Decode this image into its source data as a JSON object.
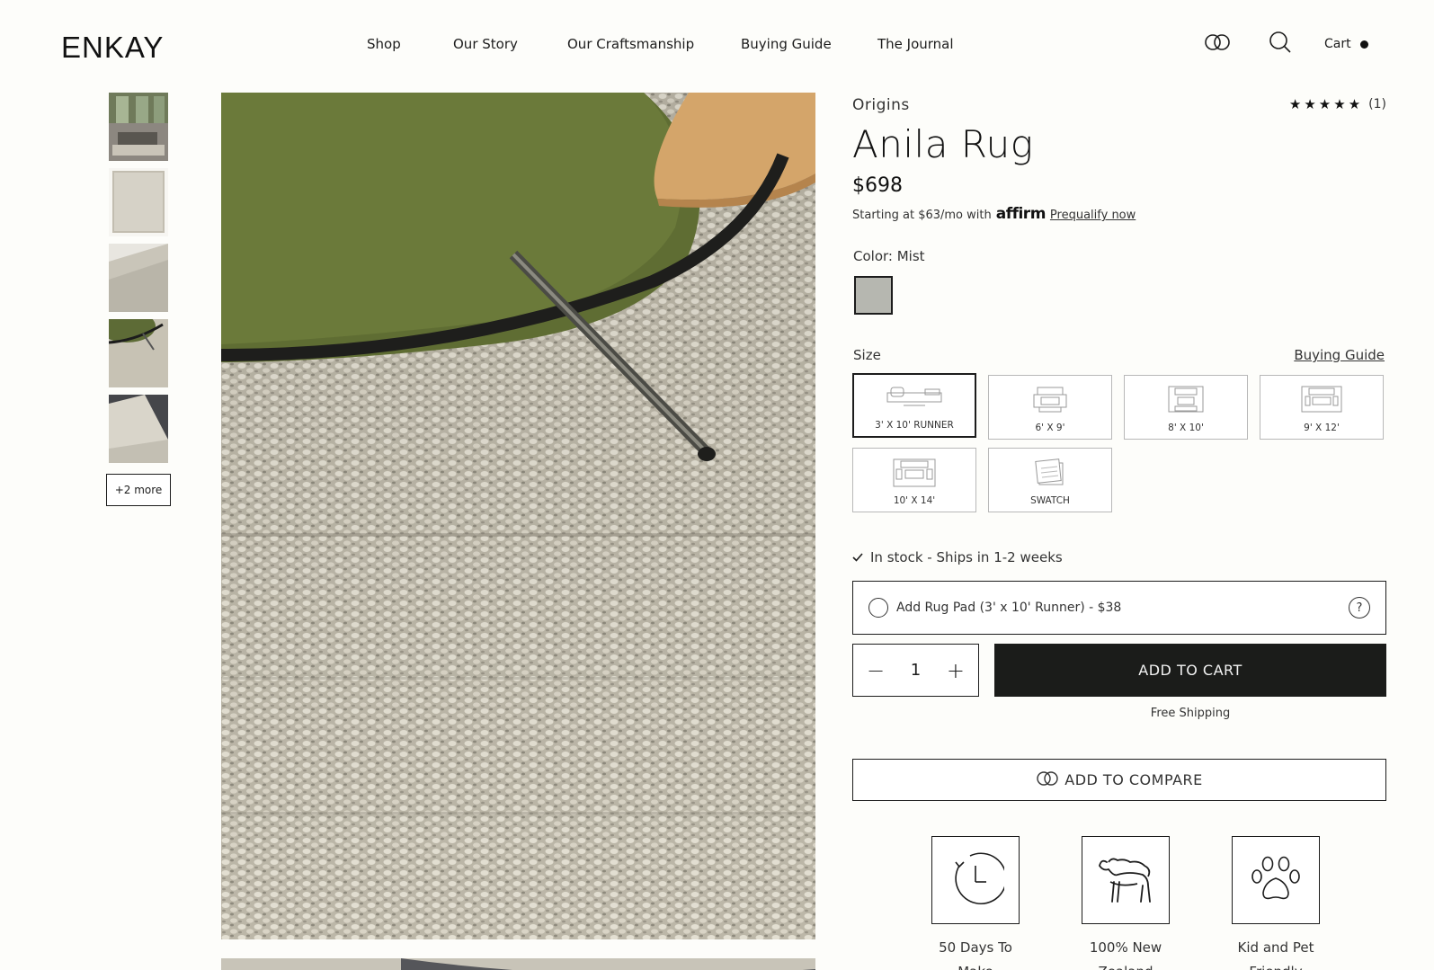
{
  "header": {
    "logo": "ENKAY",
    "nav": [
      {
        "label": "Shop"
      },
      {
        "label": "Our Story"
      },
      {
        "label": "Our Craftsmanship"
      },
      {
        "label": "Buying Guide"
      },
      {
        "label": "The Journal"
      }
    ],
    "icons": [
      "compare-icon",
      "search-icon"
    ],
    "cart_label": "Cart"
  },
  "gallery": {
    "more_label": "+2 more"
  },
  "product": {
    "collection": "Origins",
    "rating_stars": "★★★★★",
    "rating_count": "(1)",
    "rating_value": 5,
    "title": "Anila Rug",
    "price": "$698",
    "affirm_prefix": "Starting at $63/mo with",
    "affirm_brand": "affirm",
    "affirm_link": "Prequalify now",
    "color_label": "Color: Mist",
    "color_swatch": "#b6b7b0",
    "size_label": "Size",
    "buying_guide_link": "Buying Guide",
    "sizes": [
      {
        "label": "3' X 10' RUNNER",
        "selected": true
      },
      {
        "label": "6' X 9'",
        "selected": false
      },
      {
        "label": "8' X 10'",
        "selected": false
      },
      {
        "label": "9' X 12'",
        "selected": false
      },
      {
        "label": "10' X 14'",
        "selected": false
      },
      {
        "label": "SWATCH",
        "selected": false
      }
    ],
    "stock_text": "In stock - Ships in 1-2 weeks",
    "rug_pad_text": "Add Rug Pad (3' x 10' Runner) - $38",
    "help_glyph": "?",
    "quantity": "1",
    "minus_glyph": "−",
    "plus_glyph": "+",
    "add_to_cart": "ADD TO CART",
    "free_shipping": "Free Shipping",
    "add_to_compare": "ADD TO COMPARE",
    "features": [
      {
        "line1": "50 Days To",
        "line2": "Make",
        "icon": "clock-icon"
      },
      {
        "line1": "100% New",
        "line2": "Zealand",
        "icon": "sheep-icon"
      },
      {
        "line1": "Kid and Pet",
        "line2": "Friendly",
        "icon": "paw-icon"
      }
    ]
  },
  "colors": {
    "button_dark": "#1b1c1a",
    "background": "#fdfdfa",
    "text": "#1c1c1c"
  }
}
